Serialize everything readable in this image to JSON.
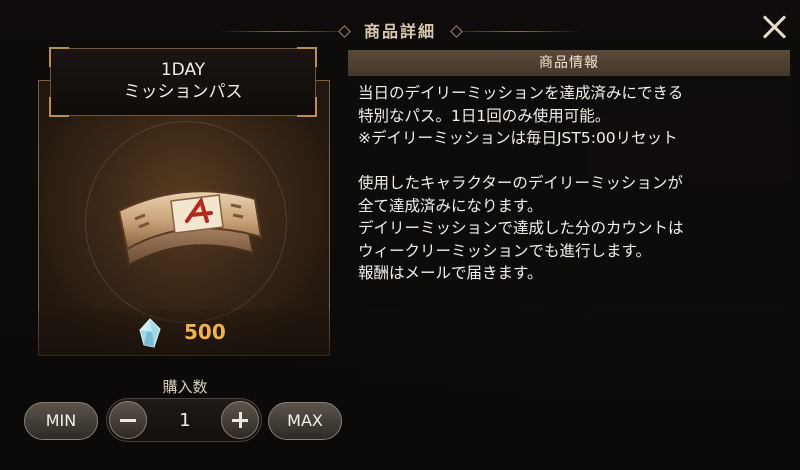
{
  "modal": {
    "title": "商品詳細"
  },
  "item": {
    "name_line1": "1DAY",
    "name_line2": "ミッションパス",
    "price": "500",
    "price_icon": "crystal-gem-icon"
  },
  "quantity": {
    "label": "購入数",
    "value": "1",
    "min_label": "MIN",
    "max_label": "MAX"
  },
  "info": {
    "header": "商品情報",
    "description": "当日のデイリーミッションを達成済みにできる\n特別なパス。1日1回のみ使用可能。\n※デイリーミッションは毎日JST5:00リセット\n\n使用したキャラクターのデイリーミッションが\n全て達成済みになります。\nデイリーミッションで達成した分のカウントは\nウィークリーミッションでも進行します。\n報酬はメールで届きます。"
  },
  "colors": {
    "price": "#f0b34a",
    "accent_border": "#b9904f",
    "info_header_bg": "#4f4030"
  }
}
